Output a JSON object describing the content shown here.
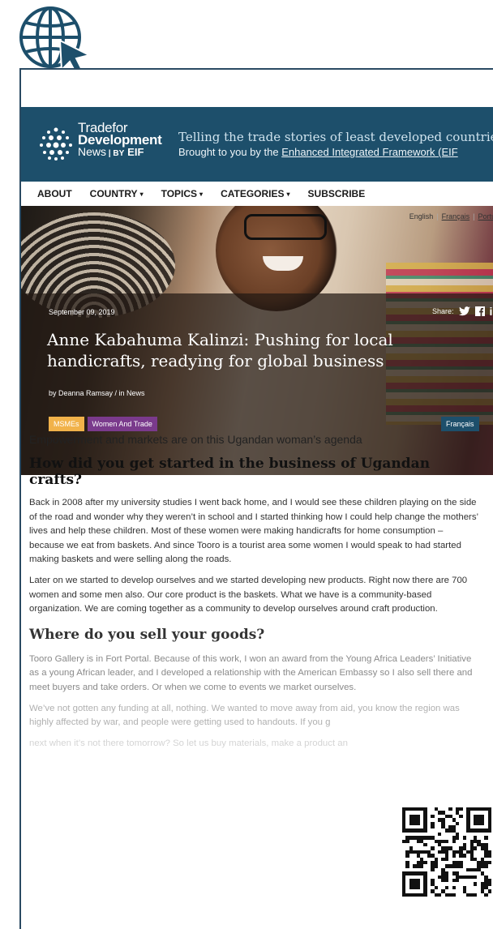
{
  "site": {
    "logo": {
      "trade": "Trade",
      "for": "for",
      "development": "Development",
      "news": "News",
      "by": "BY",
      "eif": "EIF"
    },
    "tagline_main": "Telling the trade stories of least developed countrie",
    "tagline_sub_prefix": "Brought to you by the ",
    "tagline_sub_link": "Enhanced Integrated Framework (EIF"
  },
  "nav": {
    "items": [
      {
        "label": "ABOUT",
        "dropdown": false
      },
      {
        "label": "COUNTRY",
        "dropdown": true
      },
      {
        "label": "TOPICS",
        "dropdown": true
      },
      {
        "label": "CATEGORIES",
        "dropdown": true
      },
      {
        "label": "SUBSCRIBE",
        "dropdown": false
      }
    ],
    "caret": "▾"
  },
  "languages": {
    "english": "English",
    "french": "Français",
    "portuguese": "Portuguê"
  },
  "hero": {
    "date": "September 09, 2019",
    "share_label": "Share:",
    "title": "Anne Kabahuma Kalinzi: Pushing for local handicrafts, readying for global business",
    "byline": "by Deanna Ramsay / in News",
    "tags": [
      "MSMEs",
      "Women And Trade"
    ],
    "translation_button": "Français"
  },
  "article": {
    "intro": "Empowerment and markets are on this Ugandan woman’s agenda",
    "heading1": "How did you get started in the business of Ugandan crafts?",
    "para1": "Back in 2008 after my university studies I went back home, and I would see these children playing on the side of the road and wonder why they weren’t in school and I started thinking how I could help change the mothers’ lives and help these children. Most of these women were making handicrafts for home consumption – because we eat from baskets. And since Tooro is a tourist area some women I would speak to had started making baskets and were selling along the roads.",
    "para2": "Later on we started to develop ourselves and we started developing new products. Right now there are 700 women and some men also. Our core product is the baskets. What we have is a community-based organization. We are coming together as a community to develop ourselves around craft production.",
    "heading2": "Where do you sell your goods?",
    "para3": "Tooro Gallery is in Fort Portal. Because of this work, I won an award from the Young Africa Leaders’ Initiative as a young African leader, and I developed a relationship with the American Embassy so I also sell there and meet buyers and take orders. Or when we come to events we market ourselves.",
    "para4": "We’ve not gotten any funding at all, nothing. We wanted to move away from aid, you know the region was highly affected by war, and people were getting used to handouts. If you g",
    "para5": "next when it’s not there tomorrow? So let us buy materials, make a product an"
  },
  "colors": {
    "brand": "#1d4f6b",
    "msme_tag": "#f1b24a",
    "women_tag": "#7a3a8c"
  },
  "icons": {
    "globe": "globe-cursor-icon",
    "twitter": "twitter-icon",
    "facebook": "facebook-icon",
    "linkedin": "linkedin-icon",
    "qr": "qr-code"
  }
}
